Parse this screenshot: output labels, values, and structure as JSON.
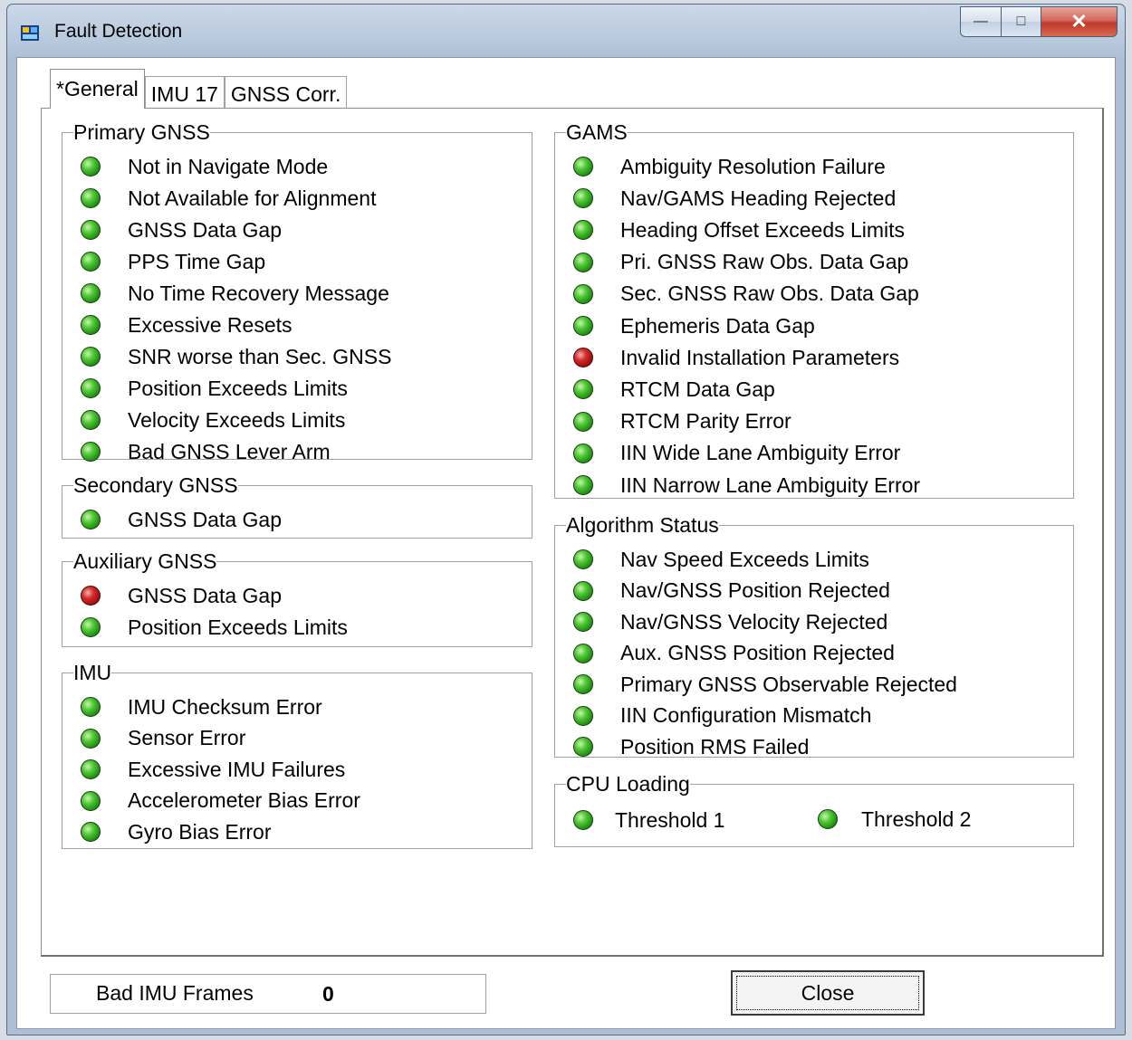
{
  "window": {
    "title": "Fault Detection",
    "min_glyph": "—",
    "max_glyph": "□",
    "close_glyph": "✕"
  },
  "tabs": [
    {
      "label": "*General",
      "active": true
    },
    {
      "label": "IMU 17",
      "active": false
    },
    {
      "label": "GNSS Corr.",
      "active": false
    }
  ],
  "colors": {
    "ok": "#2fa41c",
    "fault": "#c41818"
  },
  "groups": {
    "primary_gnss": {
      "label": "Primary GNSS",
      "items": [
        {
          "label": "Not in Navigate Mode",
          "status": "ok"
        },
        {
          "label": "Not Available for Alignment",
          "status": "ok"
        },
        {
          "label": "GNSS Data Gap",
          "status": "ok"
        },
        {
          "label": "PPS Time Gap",
          "status": "ok"
        },
        {
          "label": "No Time Recovery Message",
          "status": "ok"
        },
        {
          "label": "Excessive Resets",
          "status": "ok"
        },
        {
          "label": "SNR worse than Sec. GNSS",
          "status": "ok"
        },
        {
          "label": "Position Exceeds Limits",
          "status": "ok"
        },
        {
          "label": "Velocity Exceeds Limits",
          "status": "ok"
        },
        {
          "label": "Bad GNSS Lever Arm",
          "status": "ok"
        }
      ]
    },
    "secondary_gnss": {
      "label": "Secondary GNSS",
      "items": [
        {
          "label": "GNSS Data Gap",
          "status": "ok"
        }
      ]
    },
    "auxiliary_gnss": {
      "label": "Auxiliary GNSS",
      "items": [
        {
          "label": "GNSS Data Gap",
          "status": "fault"
        },
        {
          "label": "Position Exceeds Limits",
          "status": "ok"
        }
      ]
    },
    "imu": {
      "label": "IMU",
      "items": [
        {
          "label": "IMU Checksum Error",
          "status": "ok"
        },
        {
          "label": "Sensor Error",
          "status": "ok"
        },
        {
          "label": "Excessive IMU Failures",
          "status": "ok"
        },
        {
          "label": "Accelerometer Bias Error",
          "status": "ok"
        },
        {
          "label": "Gyro Bias Error",
          "status": "ok"
        }
      ]
    },
    "gams": {
      "label": "GAMS",
      "items": [
        {
          "label": "Ambiguity Resolution Failure",
          "status": "ok"
        },
        {
          "label": "Nav/GAMS Heading Rejected",
          "status": "ok"
        },
        {
          "label": "Heading Offset Exceeds Limits",
          "status": "ok"
        },
        {
          "label": "Pri. GNSS Raw Obs. Data Gap",
          "status": "ok"
        },
        {
          "label": "Sec. GNSS Raw Obs. Data Gap",
          "status": "ok"
        },
        {
          "label": "Ephemeris Data Gap",
          "status": "ok"
        },
        {
          "label": "Invalid Installation Parameters",
          "status": "fault"
        },
        {
          "label": "RTCM Data Gap",
          "status": "ok"
        },
        {
          "label": "RTCM Parity Error",
          "status": "ok"
        },
        {
          "label": "IIN Wide Lane Ambiguity Error",
          "status": "ok"
        },
        {
          "label": "IIN Narrow Lane Ambiguity Error",
          "status": "ok"
        }
      ]
    },
    "algorithm_status": {
      "label": "Algorithm Status",
      "items": [
        {
          "label": "Nav Speed Exceeds Limits",
          "status": "ok"
        },
        {
          "label": "Nav/GNSS Position Rejected",
          "status": "ok"
        },
        {
          "label": "Nav/GNSS Velocity Rejected",
          "status": "ok"
        },
        {
          "label": "Aux. GNSS Position Rejected",
          "status": "ok"
        },
        {
          "label": "Primary GNSS Observable Rejected",
          "status": "ok"
        },
        {
          "label": "IIN Configuration Mismatch",
          "status": "ok"
        },
        {
          "label": "Position RMS Failed",
          "status": "ok"
        }
      ]
    },
    "cpu_loading": {
      "label": "CPU Loading",
      "items": [
        {
          "label": "Threshold 1",
          "status": "ok"
        },
        {
          "label": "Threshold 2",
          "status": "ok"
        }
      ]
    }
  },
  "footer": {
    "bad_imu_frames_label": "Bad IMU Frames",
    "bad_imu_frames_value": "0",
    "close_label": "Close"
  }
}
